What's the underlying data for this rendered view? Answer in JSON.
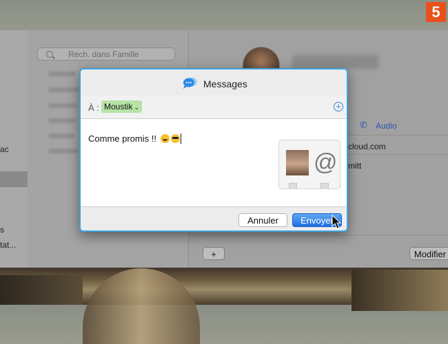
{
  "step_badge": "5",
  "background_app": {
    "search_placeholder": "Rech. dans Famille",
    "left_fragments": [
      "ac",
      "s",
      "tat..."
    ],
    "contact_name": "Camille Schmitt",
    "audio_label": "Audio",
    "email_fragment": "cloud.com",
    "name_fragment": "mitt",
    "add_label": "+",
    "edit_label": "Modifier"
  },
  "dialog": {
    "title": "Messages",
    "to_label": "À :",
    "recipient": "Moustik",
    "recipient_chevron": "⌄",
    "add_recipient_icon": "+",
    "message_text": "Comme promis !! ",
    "emojis": [
      "laughing-face-icon",
      "sunglasses-face-icon"
    ],
    "attachment_icon": "@",
    "cancel_label": "Annuler",
    "send_label": "Envoyer"
  },
  "colors": {
    "accent": "#3ca2de",
    "send_button": "#1f6fe0",
    "chip": "#b7e2a8",
    "badge": "#e8501c"
  }
}
